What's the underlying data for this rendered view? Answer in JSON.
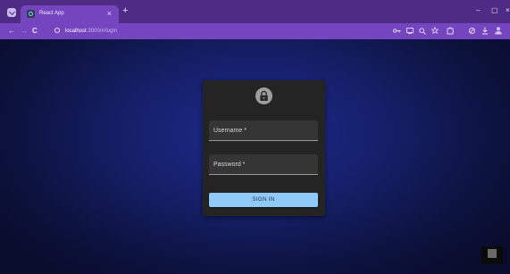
{
  "browser": {
    "tab_title": "React App",
    "tab_close": "×",
    "new_tab": "+",
    "url_host": "localhost",
    "url_path": ":3000/#/login",
    "window_minimize": "–",
    "window_maximize": "▢",
    "window_close": "×"
  },
  "toolbar": {
    "back_icon": "←",
    "forward_icon": "→",
    "reload_icon": "C",
    "icons": [
      "key-icon",
      "cast-icon",
      "zoom-icon",
      "star-icon",
      "extension-icon",
      "sidebar-icon",
      "download-icon",
      "profile-icon"
    ]
  },
  "login": {
    "username_label": "Username *",
    "password_label": "Password *",
    "signin_label": "SIGN IN"
  },
  "colors": {
    "tabstrip": "#4e2c86",
    "toolbar": "#7545c0",
    "card": "#242424",
    "button": "#90caf9"
  }
}
